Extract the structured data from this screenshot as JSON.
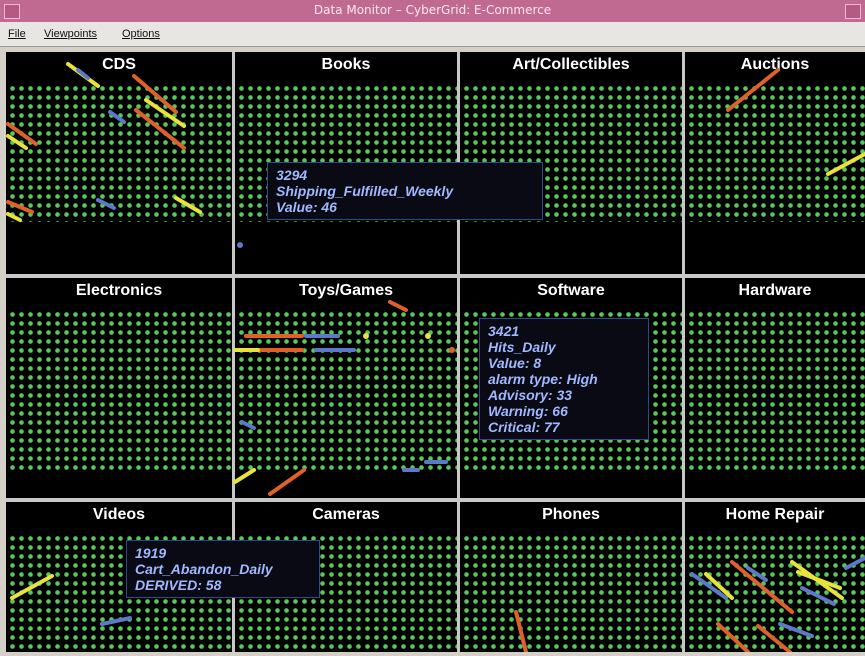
{
  "window": {
    "title": "Data Monitor – CyberGrid: E-Commerce"
  },
  "menu": [
    "File",
    "Viewpoints",
    "Options"
  ],
  "panels": [
    "CDS",
    "Books",
    "Art/Collectibles",
    "Auctions",
    "Electronics",
    "Toys/Games",
    "Software",
    "Hardware",
    "Videos",
    "Cameras",
    "Phones",
    "Home Repair"
  ],
  "tooltips": [
    {
      "lines": [
        "3294",
        "Shipping_Fulfilled_Weekly",
        "Value: 46"
      ]
    },
    {
      "lines": [
        "3421",
        "Hits_Daily",
        "Value: 8",
        "alarm type: High",
        "Advisory: 33",
        "Warning: 66",
        "Critical: 77"
      ]
    },
    {
      "lines": [
        "1919",
        "Cart_Abandon_Daily",
        "DERIVED: 58"
      ]
    }
  ],
  "colors": {
    "grid": "#58c85a",
    "titlebar": "#c06a92",
    "alarm_yellow": "#e8e23a",
    "alarm_orange": "#e0602a",
    "alarm_blue": "#5a79c8"
  }
}
